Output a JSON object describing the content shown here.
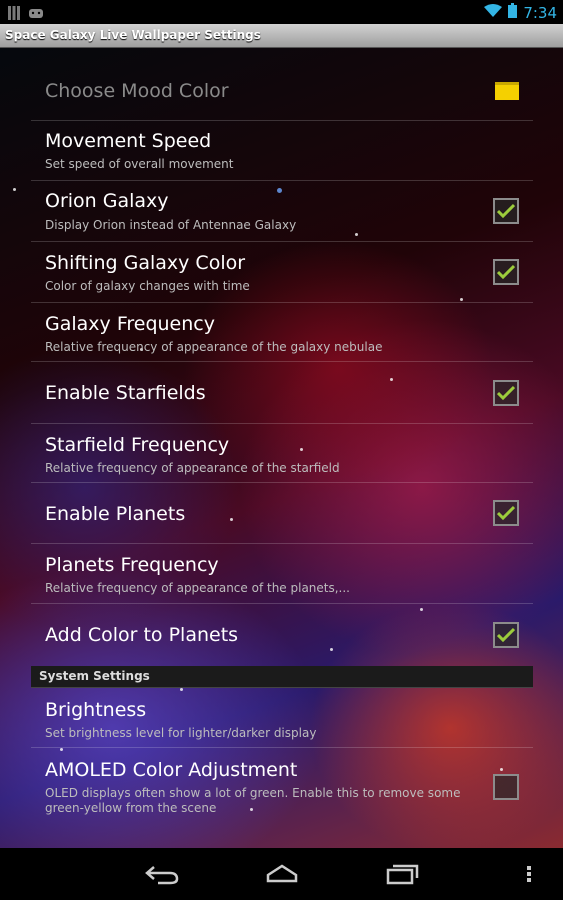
{
  "status_bar": {
    "time": "7:34",
    "icons": [
      "notification-grid-icon",
      "android-icon",
      "wifi-icon",
      "battery-icon"
    ]
  },
  "title_bar": {
    "title": "Space Galaxy Live Wallpaper Settings"
  },
  "settings": [
    {
      "title": "Choose Mood Color",
      "summary": "",
      "disabled": true,
      "widget": "color-swatch",
      "swatch_color": "#f5d000"
    },
    {
      "title": "Movement Speed",
      "summary": "Set speed of overall movement",
      "widget": "none"
    },
    {
      "title": "Orion Galaxy",
      "summary": "Display Orion instead of Antennae Galaxy",
      "widget": "checkbox",
      "checked": true
    },
    {
      "title": "Shifting Galaxy Color",
      "summary": "Color of galaxy changes with time",
      "widget": "checkbox",
      "checked": true
    },
    {
      "title": "Galaxy Frequency",
      "summary": "Relative frequency of appearance of the galaxy nebulae",
      "widget": "none"
    },
    {
      "title": "Enable Starfields",
      "summary": "",
      "widget": "checkbox",
      "checked": true
    },
    {
      "title": "Starfield Frequency",
      "summary": "Relative frequency of appearance of the starfield",
      "widget": "none"
    },
    {
      "title": "Enable Planets",
      "summary": "",
      "widget": "checkbox",
      "checked": true
    },
    {
      "title": "Planets Frequency",
      "summary": "Relative frequency of appearance of the planets,...",
      "widget": "none"
    },
    {
      "title": "Add Color to Planets",
      "summary": "",
      "widget": "checkbox",
      "checked": true
    }
  ],
  "system_section": {
    "header": "System Settings",
    "items": [
      {
        "title": "Brightness",
        "summary": "Set brightness level for lighter/darker display",
        "widget": "none"
      },
      {
        "title": "AMOLED Color Adjustment",
        "summary": "OLED displays often show a lot of green. Enable this to remove some green-yellow from the scene",
        "widget": "checkbox",
        "checked": false
      }
    ]
  },
  "nav_bar": {
    "buttons": [
      "back-icon",
      "home-icon",
      "recent-apps-icon",
      "menu-icon"
    ]
  },
  "colors": {
    "accent": "#33b5e5",
    "checkmark": "#9ccc3c",
    "swatch": "#f5d000"
  }
}
